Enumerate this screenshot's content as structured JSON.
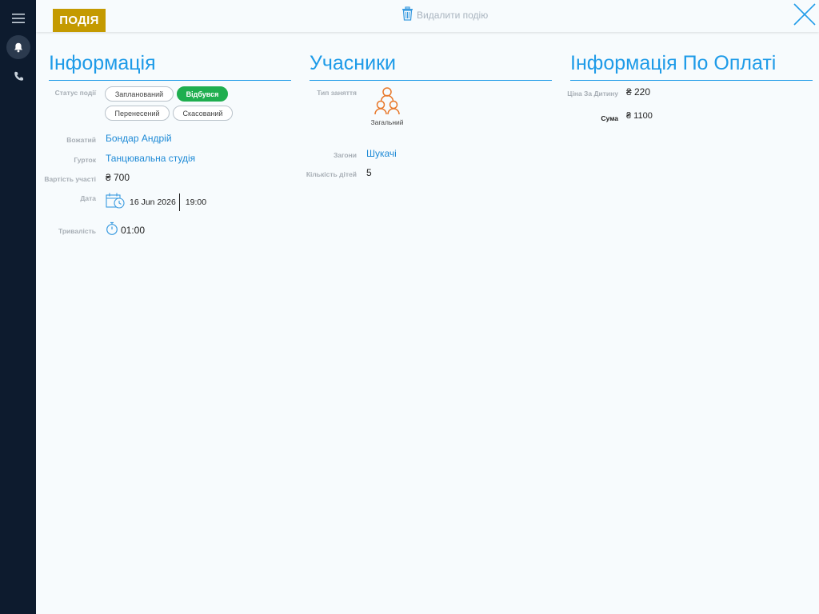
{
  "sidebar": {
    "menu_icon": "menu-icon",
    "bell_icon": "bell-icon",
    "phone_icon": "phone-icon"
  },
  "header": {
    "badge": "ПОДІЯ",
    "delete_label": "Видалити подію",
    "delete_icon": "trash-icon",
    "close_icon": "close-icon"
  },
  "info": {
    "title": "Інформація",
    "status_label": "Статус події",
    "statuses": [
      "Запланований",
      "Відбувся",
      "Перенесений",
      "Скасований"
    ],
    "active_status": "Відбувся",
    "leader_label": "Вожатий",
    "leader": "Бондар Андрій",
    "club_label": "Гурток",
    "club": "Танцювальна студія",
    "cost_label": "Вартість участі",
    "cost": "₴ 700",
    "date_label": "Дата",
    "date": "16 Jun 2026",
    "time": "19:00",
    "duration_label": "Тривалість",
    "duration": "01:00"
  },
  "participants": {
    "title": "Учасники",
    "type_label": "Тип заняття",
    "type_value": "Загальний",
    "groups_label": "Загони",
    "groups": "Шукачі",
    "count_label": "Кількість дітей",
    "count": "5"
  },
  "payment": {
    "title": "Інформація По Оплаті",
    "price_label": "Ціна За Дитину",
    "price": "₴ 220",
    "sum_label": "Сума",
    "sum": "₴ 1100"
  },
  "colors": {
    "accent": "#1e9be8",
    "badge": "#c49a00",
    "active": "#1fae4f",
    "sidebar": "#0d1b2e",
    "group_icon": "#e8782a"
  }
}
